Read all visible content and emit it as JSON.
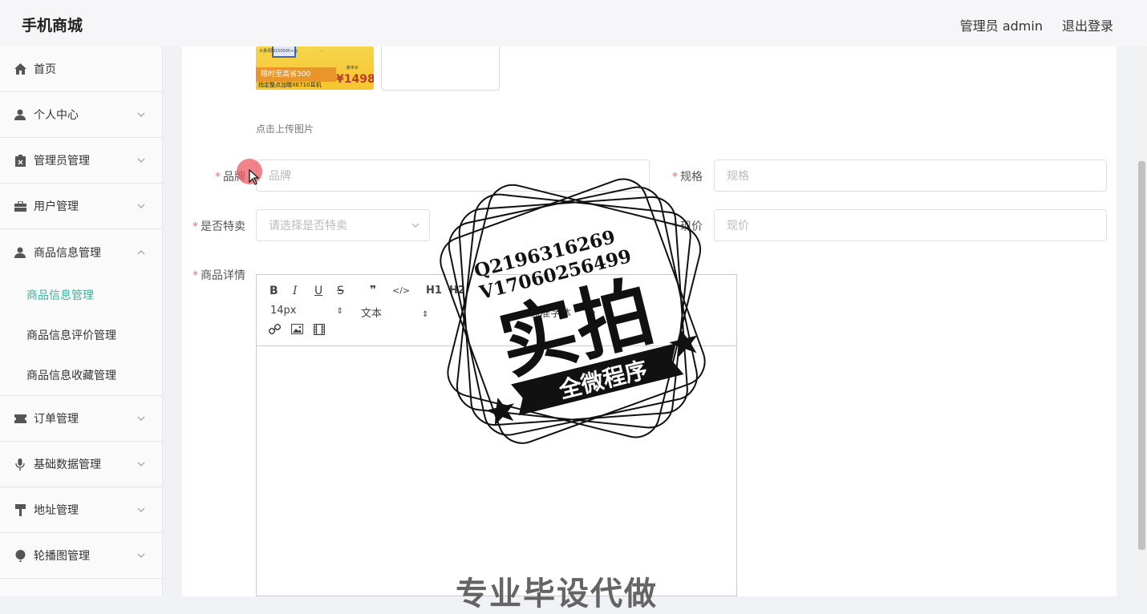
{
  "app": {
    "title": "手机商城"
  },
  "header": {
    "admin_label": "管理员 admin",
    "logout_label": "退出登录"
  },
  "sidebar": {
    "items": [
      {
        "label": "首页",
        "icon": "home-icon"
      },
      {
        "label": "个人中心",
        "icon": "user-icon"
      },
      {
        "label": "管理员管理",
        "icon": "clipboard-icon"
      },
      {
        "label": "用户管理",
        "icon": "briefcase-icon"
      },
      {
        "label": "商品信息管理",
        "icon": "user-icon"
      },
      {
        "label": "订单管理",
        "icon": "ticket-icon"
      },
      {
        "label": "基础数据管理",
        "icon": "microphone-icon"
      },
      {
        "label": "地址管理",
        "icon": "paint-roller-icon"
      },
      {
        "label": "轮播图管理",
        "icon": "balloon-icon"
      }
    ],
    "submenu": [
      {
        "label": "商品信息管理",
        "active": true
      },
      {
        "label": "商品信息评价管理",
        "active": false
      },
      {
        "label": "商品信息收藏管理",
        "active": false
      }
    ]
  },
  "form": {
    "thumbnail": {
      "top_text": "大量领取150000+台",
      "red_text": "...",
      "band_text": "限时至高省300",
      "bottom_text": "指定整点加赠XE710耳机",
      "price_label": "新手价",
      "price": "¥1498"
    },
    "upload_hint": "点击上传图片",
    "brand": {
      "label": "品牌",
      "placeholder": "品牌"
    },
    "spec": {
      "label": "规格",
      "placeholder": "规格"
    },
    "special": {
      "label": "是否特卖",
      "placeholder": "请选择是否特卖"
    },
    "price": {
      "label": "现价",
      "placeholder": "现价"
    },
    "detail": {
      "label": "商品详情"
    },
    "required_mark": "*"
  },
  "editor": {
    "font_size": "14px",
    "block_type": "文本",
    "font_family": "标准字体",
    "buttons": [
      "B",
      "I",
      "U",
      "S",
      "❞",
      "</>",
      "H1",
      "H2"
    ]
  },
  "watermark": {
    "contact1": "Q2196316269",
    "contact2": "V17060256499",
    "big": "实拍",
    "banner": "全微程序",
    "bottom": "专业毕设代做"
  }
}
